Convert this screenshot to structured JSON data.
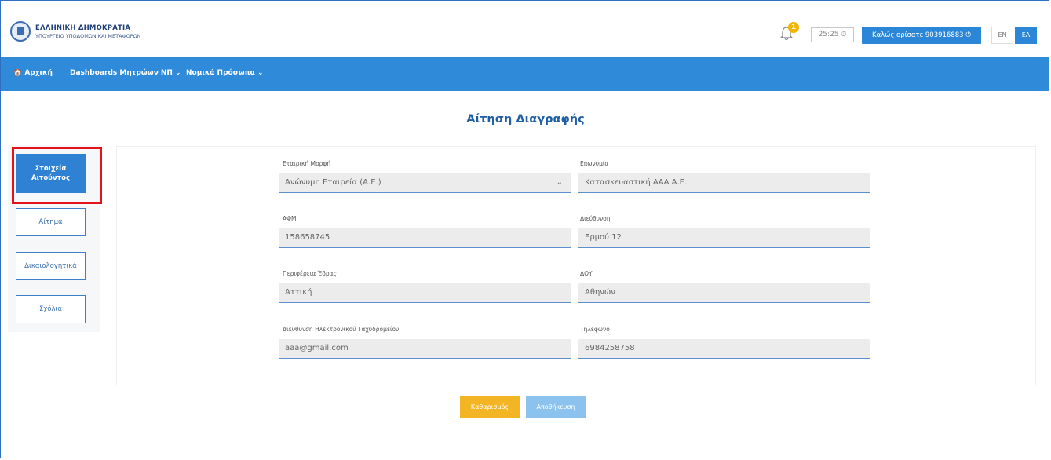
{
  "header": {
    "brand_title": "ΕΛΛΗΝΙΚΗ ΔΗΜΟΚΡΑΤΙΑ",
    "brand_subtitle": "ΥΠΟΥΡΓΕΙΟ ΥΠΟΔΟΜΩΝ ΚΑΙ ΜΕΤΑΦΟΡΩΝ",
    "notification_count": "1",
    "timer": "25:25 ⏱",
    "welcome": "Καλώς ορίσατε 903916883 ⏻",
    "lang_en": "EN",
    "lang_el": "ΕΛ",
    "accent_color": "#2f8ad9"
  },
  "nav": {
    "home": "🏠 Αρχική",
    "dashboards": "Dashboards Μητρώων ΝΠ ⌄",
    "legal_entities": "Νομικά Πρόσωπα ⌄"
  },
  "page": {
    "title": "Αίτηση Διαγραφής"
  },
  "sidebar": {
    "items": [
      {
        "label": "Στοιχεία Αιτούντος"
      },
      {
        "label": "Αίτημα"
      },
      {
        "label": "Δικαιολογητικά"
      },
      {
        "label": "Σχόλια"
      }
    ]
  },
  "form": {
    "company_form": {
      "label": "Εταιρική Μορφή",
      "value": "Ανώνυμη Εταιρεία (Α.Ε.)"
    },
    "name": {
      "label": "Επωνυμία",
      "value": "Κατασκευαστική ΑΑΑ Α.Ε."
    },
    "afm": {
      "label": "ΑΦΜ",
      "value": "158658745"
    },
    "address": {
      "label": "Διεύθυνση",
      "value": "Ερμού 12"
    },
    "region": {
      "label": "Περιφέρεια Έδρας",
      "value": "Αττική"
    },
    "doy": {
      "label": "ΔΟΥ",
      "value": "Αθηνών"
    },
    "email": {
      "label": "Διεύθυνση Ηλεκτρονικού Ταχυδρομείου",
      "value": "aaa@gmail.com"
    },
    "phone": {
      "label": "Τηλέφωνο",
      "value": "6984258758"
    }
  },
  "actions": {
    "clear": "Καθαρισμός",
    "save": "Αποθήκευση"
  }
}
